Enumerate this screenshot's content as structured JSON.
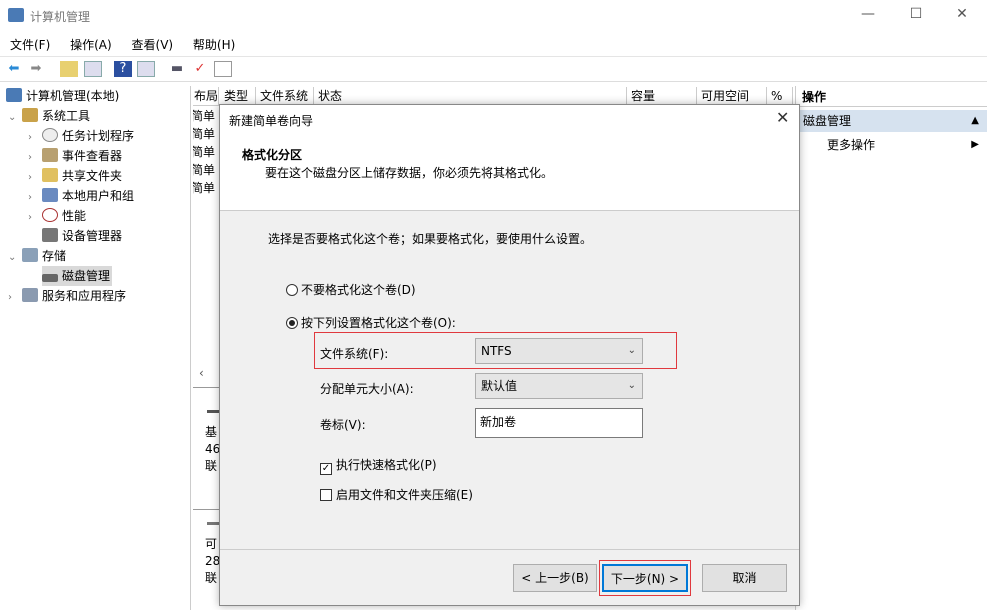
{
  "window": {
    "title": "计算机管理",
    "minimize": "—",
    "maximize": "☐",
    "close": "✕"
  },
  "menu": [
    "文件(F)",
    "操作(A)",
    "查看(V)",
    "帮助(H)"
  ],
  "toolbar": [
    "back-icon",
    "forward-icon",
    "up-folder-icon",
    "show-hide-console-tree-icon",
    "help-icon",
    "show-hide-action-pane-icon",
    "disk-icon",
    "checklist-icon",
    "properties-icon"
  ],
  "tree": {
    "root": "计算机管理(本地)",
    "items": [
      {
        "label": "系统工具",
        "level": 1,
        "expanded": true
      },
      {
        "label": "任务计划程序",
        "level": 2
      },
      {
        "label": "事件查看器",
        "level": 2
      },
      {
        "label": "共享文件夹",
        "level": 2
      },
      {
        "label": "本地用户和组",
        "level": 2
      },
      {
        "label": "性能",
        "level": 2
      },
      {
        "label": "设备管理器",
        "level": 2
      },
      {
        "label": "存储",
        "level": 1,
        "expanded": true
      },
      {
        "label": "磁盘管理",
        "level": 2,
        "selected": true
      },
      {
        "label": "服务和应用程序",
        "level": 1
      }
    ]
  },
  "volume_list": {
    "columns": [
      "布局",
      "类型",
      "文件系统",
      "状态",
      "容量",
      "可用空间",
      "%"
    ],
    "rows": [
      "简单",
      "简单",
      "简单",
      "简单",
      "简单"
    ],
    "disks": [
      {
        "l1": "基",
        "l2": "46",
        "l3": "联"
      },
      {
        "l1": "可",
        "l2": "28",
        "l3": "联"
      }
    ]
  },
  "actions": {
    "header": "操作",
    "section": "磁盘管理",
    "more": "更多操作"
  },
  "dialog": {
    "title": "新建简单卷向导",
    "heading": "格式化分区",
    "subheading": "要在这个磁盘分区上储存数据，你必须先将其格式化。",
    "prompt": "选择是否要格式化这个卷；如果要格式化，要使用什么设置。",
    "radio_no": "不要格式化这个卷(D)",
    "radio_yes": "按下列设置格式化这个卷(O):",
    "fs_label": "文件系统(F):",
    "fs_value": "NTFS",
    "alloc_label": "分配单元大小(A):",
    "alloc_value": "默认值",
    "vol_label": "卷标(V):",
    "vol_value": "新加卷",
    "quick_format": "执行快速格式化(P)",
    "quick_format_checked": true,
    "compress": "启用文件和文件夹压缩(E)",
    "compress_checked": false,
    "back": "< 上一步(B)",
    "next": "下一步(N) >",
    "cancel": "取消",
    "highlight_color": "#e0393e"
  }
}
